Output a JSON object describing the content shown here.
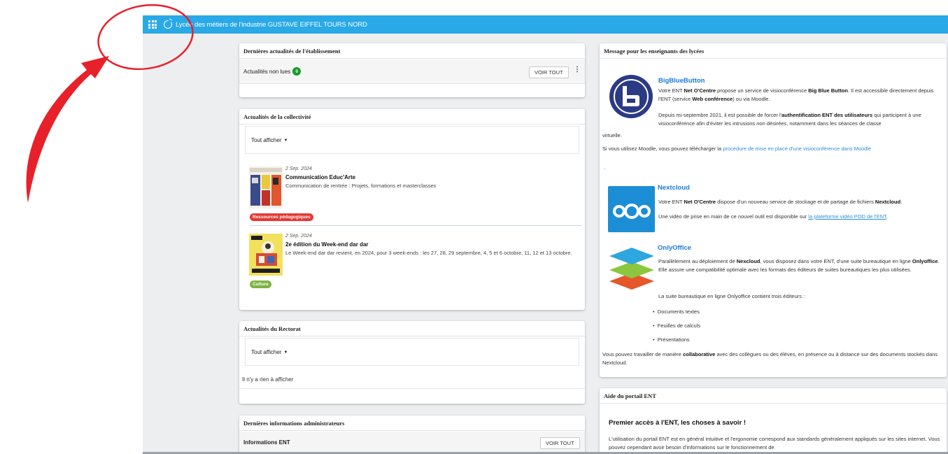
{
  "topbar": {
    "title": "Lycée des métiers de l'industrie GUSTAVE EIFFEL TOURS NORD",
    "bg_color": "#29a9e6"
  },
  "card_actualites_etab": {
    "header": "Dernières actualités de l'établissement",
    "unread_label": "Actualités non lues",
    "unread_count": "0",
    "voir_tout": "VOIR TOUT",
    "menu_glyph": "⋮"
  },
  "card_collectivite": {
    "header": "Actualités de la collectivité",
    "filter_label": "Tout afficher",
    "items": [
      {
        "date": "2 Sep. 2024",
        "title": "Communication Educ'Arte",
        "description": "Communication de rentrée : Projets, formations et masterclasses",
        "tag": "Ressources pédagogiques",
        "tag_color": "#e53935"
      },
      {
        "date": "2 Sep. 2024",
        "title": "2e édition du Week-end dar dar",
        "description": "Le Week-end dar dar revient, en 2024, pour 3 week-ends : les 27, 28, 29 septembre, 4, 5 et 6 octobre, 11, 12 et 13 octobre.",
        "tag": "Culture",
        "tag_color": "#7cb342"
      }
    ]
  },
  "card_rectorat": {
    "header": "Actualités du Rectorat",
    "filter_label": "Tout afficher",
    "empty_text": "Il n'y a rien à afficher"
  },
  "card_admin": {
    "header": "Dernières informations administrateurs",
    "row_label": "Informations ENT",
    "voir_tout": "VOIR TOUT"
  },
  "card_message": {
    "header": "Message pour les enseignants des lycées",
    "bbb": {
      "title": "BigBlueButton",
      "p1_a": "Votre ENT ",
      "p1_b": "Net O'Centre",
      "p1_c": " propose un service de visioconférence ",
      "p1_d": "Big Blue Button",
      "p1_e": ". Il  est accessible directement depuis l'ENT (service ",
      "p1_f": "Web conférence",
      "p1_g": ") ou via Moodle.",
      "p2_a": "Depuis mi-septembre 2021, il est possible de forcer l'",
      "p2_b": "authentification ENT des utilisateurs",
      "p2_c": " qui participent à une visioconférence afin d'éviter les intrusions non désirées, notamment dans les séances de classe",
      "p2_tail": "virtuelle.",
      "p3_a": "Si vous utilisez Moodle, vous pouvez télécharger la ",
      "p3_link": "procédure de mise en place d'une visioconférence dans Moodle",
      "dot": "."
    },
    "nextcloud": {
      "title": "Nextcloud",
      "p1_a": "Votre ENT ",
      "p1_b": "Net O'Centre",
      "p1_c": " dispose d'un nouveau service de stockage et de partage de fichiers ",
      "p1_d": "Nextcloud",
      "p1_e": ".",
      "p2_a": "Une vidéo de prise en main de ce nouvel outil est disponible sur ",
      "p2_link": "la plateforme vidéo POD de l'ENT",
      "p2_e": "."
    },
    "onlyoffice": {
      "title": "OnlyOffice",
      "p1_a": "Parallèlement au déploiement de ",
      "p1_b": "Nexcloud",
      "p1_c": ", vous disposez dans votre ENT, d'une suite bureautique en ligne ",
      "p1_d": "Onlyoffice",
      "p1_e": ". Elle assure une compatibilité optimale avec les formats des éditeurs de suites bureautiques les plus utilisées.",
      "p2": "La suite bureautique en ligne Onlyoffice contient trois éditeurs :",
      "bullets": [
        "Documents textes",
        "Feuilles de calculs",
        "Présentations"
      ],
      "p3_a": "Vous pouvez travailler de manière ",
      "p3_b": "collaborative",
      "p3_c": " avec des collègues ou des élèves, en présence ou à distance sur des documents stockés dans Nextcloud."
    }
  },
  "card_aide": {
    "header": "Aide du portail ENT",
    "heading": "Premier accès à l'ENT, les choses à savoir !",
    "text": "L'utilisation du portail ENT est en général intuitive et l'ergonomie correspond aux standards généralement appliqués sur les sites internet. Vous pouvez cependant avoir besoin d'informations sur le fonctionnement de"
  },
  "annotation": {
    "color": "#e8202a"
  }
}
